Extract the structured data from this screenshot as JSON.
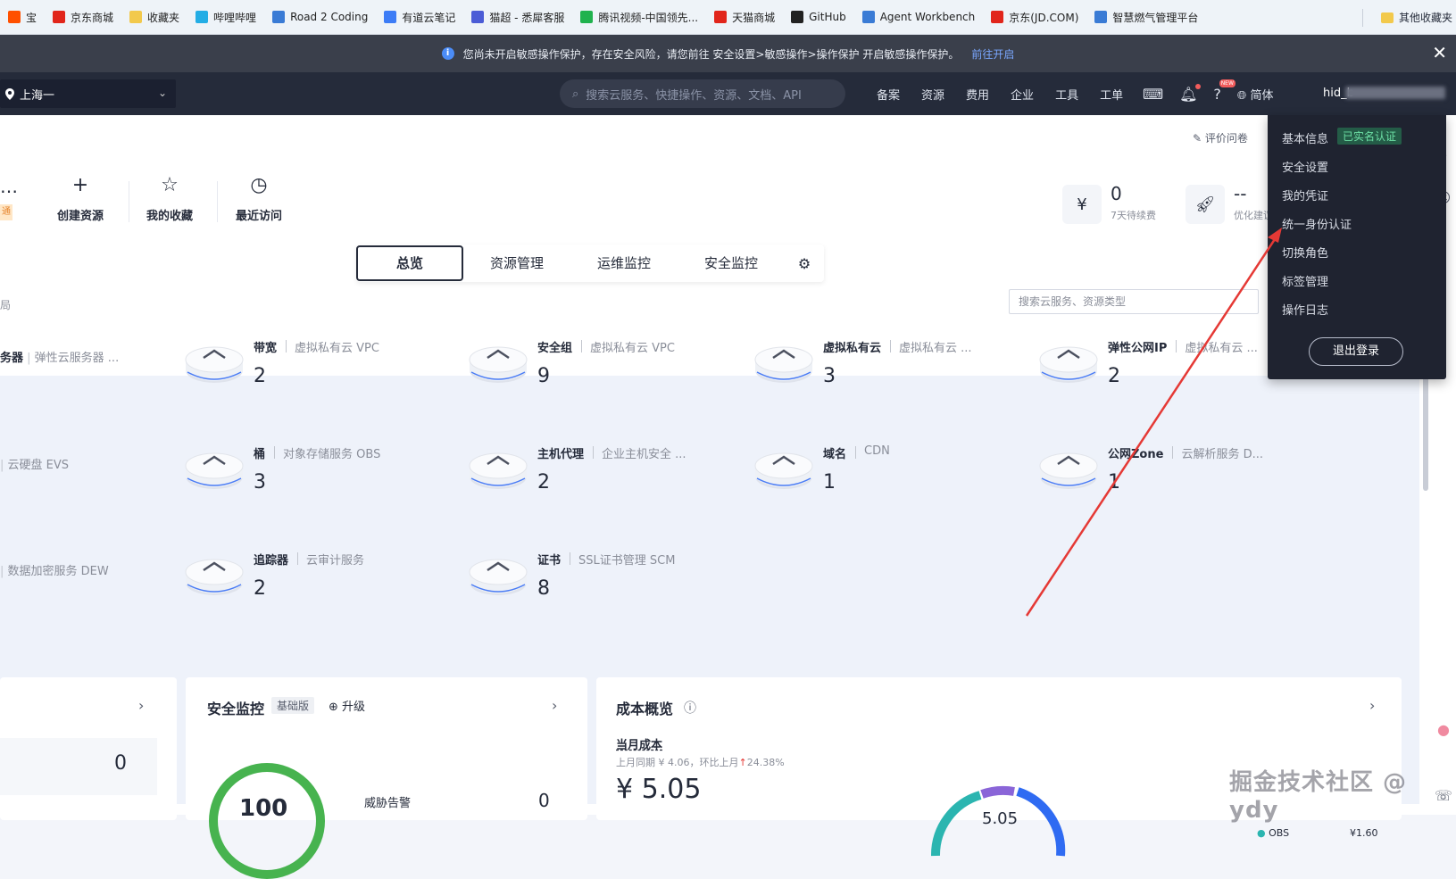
{
  "bookmarks": [
    {
      "label": "宝",
      "icon": "taobao-icon",
      "color": "#ff5000"
    },
    {
      "label": "京东商城",
      "icon": "jd-icon",
      "color": "#e1251b"
    },
    {
      "label": "收藏夹",
      "icon": "folder-icon",
      "color": "#f2c94c"
    },
    {
      "label": "哔哩哔哩",
      "icon": "bilibili-icon",
      "color": "#23ade5"
    },
    {
      "label": "Road 2 Coding",
      "icon": "footprint-icon",
      "color": "#3a7bd5"
    },
    {
      "label": "有道云笔记",
      "icon": "youdao-icon",
      "color": "#3c7cf6"
    },
    {
      "label": "猫超 - 悉犀客服",
      "icon": "cat-icon",
      "color": "#4b5cd6"
    },
    {
      "label": "腾讯视频-中国领先...",
      "icon": "tencent-video-icon",
      "color": "#20b24e"
    },
    {
      "label": "天猫商城",
      "icon": "tmall-icon",
      "color": "#e1251b"
    },
    {
      "label": "GitHub",
      "icon": "github-icon",
      "color": "#222222"
    },
    {
      "label": "Agent Workbench",
      "icon": "workbench-icon",
      "color": "#3a7bd5"
    },
    {
      "label": "京东(JD.COM)",
      "icon": "jd-icon",
      "color": "#e1251b"
    },
    {
      "label": "智慧燃气管理平台",
      "icon": "flame-icon",
      "color": "#3a7bd5"
    }
  ],
  "bookmarks_right": {
    "label": "其他收藏夹"
  },
  "banner": {
    "text": "您尚未开启敏感操作保护，存在安全风险，请您前往 安全设置>敏感操作>操作保护 开启敏感操作保护。",
    "link": "前往开启"
  },
  "topnav": {
    "region": "上海一",
    "search_placeholder": "搜索云服务、快捷操作、资源、文档、API",
    "links": [
      "备案",
      "资源",
      "费用",
      "企业",
      "工具",
      "工单"
    ],
    "lang": "简体",
    "username_prefix": "hid_b"
  },
  "quick": {
    "create": "创建资源",
    "favorites": "我的收藏",
    "recent": "最近访问",
    "orange_tag": "通"
  },
  "survey": "评价问卷",
  "stats": [
    {
      "value": "0",
      "label": "7天待续费"
    },
    {
      "value": "--",
      "label": "优化建议"
    }
  ],
  "tabs": [
    "总览",
    "资源管理",
    "运维监控",
    "安全监控"
  ],
  "left_section": "局",
  "res_search_placeholder": "搜索云服务、资源类型",
  "left_resources": [
    {
      "name": "务器",
      "svc": "弹性云服务器 ..."
    },
    {
      "name": "",
      "svc": "云硬盘 EVS"
    },
    {
      "name": "",
      "svc": "数据加密服务 DEW"
    }
  ],
  "resources": [
    {
      "name": "带宽",
      "svc": "虚拟私有云 VPC",
      "count": "2",
      "icon": "cloud-network-icon"
    },
    {
      "name": "安全组",
      "svc": "虚拟私有云 VPC",
      "count": "9",
      "icon": "cloud-network-icon"
    },
    {
      "name": "虚拟私有云",
      "svc": "虚拟私有云 ...",
      "count": "3",
      "icon": "cloud-network-icon"
    },
    {
      "name": "弹性公网IP",
      "svc": "虚拟私有云 ...",
      "count": "2",
      "icon": "cloud-network-icon"
    },
    {
      "name": "桶",
      "svc": "对象存储服务 OBS",
      "count": "3",
      "icon": "bucket-icon"
    },
    {
      "name": "主机代理",
      "svc": "企业主机安全 ...",
      "count": "2",
      "icon": "shield-host-icon"
    },
    {
      "name": "域名",
      "svc": "CDN",
      "count": "1",
      "icon": "cdn-icon"
    },
    {
      "name": "公网Zone",
      "svc": "云解析服务 D...",
      "count": "1",
      "icon": "dns-icon"
    },
    {
      "name": "追踪器",
      "svc": "云审计服务",
      "count": "2",
      "icon": "tracker-icon"
    },
    {
      "name": "证书",
      "svc": "SSL证书管理 SCM",
      "count": "8",
      "icon": "certificate-icon"
    }
  ],
  "panels": {
    "left_value": "0",
    "security": {
      "title": "安全监控",
      "tag": "基础版",
      "upgrade": "升级",
      "score": "100",
      "threat_label": "威胁告警",
      "threat_value": "0"
    },
    "cost": {
      "title": "成本概览",
      "month": "当月成本",
      "compare": "上月同期 ¥ 4.06，环比上月",
      "change": "24.38%",
      "amount": "¥ 5.05",
      "donut_center": "5.05"
    }
  },
  "cost_legend": [
    {
      "name": "OBS",
      "value": "¥1.60"
    }
  ],
  "menu": {
    "items": [
      "基本信息",
      "安全设置",
      "我的凭证",
      "统一身份认证",
      "切换角色",
      "标签管理",
      "操作日志"
    ],
    "verified": "已实名认证",
    "logout": "退出登录"
  },
  "watermark": "掘金技术社区 @ ydy",
  "colors": {
    "nav_bg": "#252b3a",
    "accent_green": "#47b34f",
    "arrow_red": "#e53935"
  }
}
